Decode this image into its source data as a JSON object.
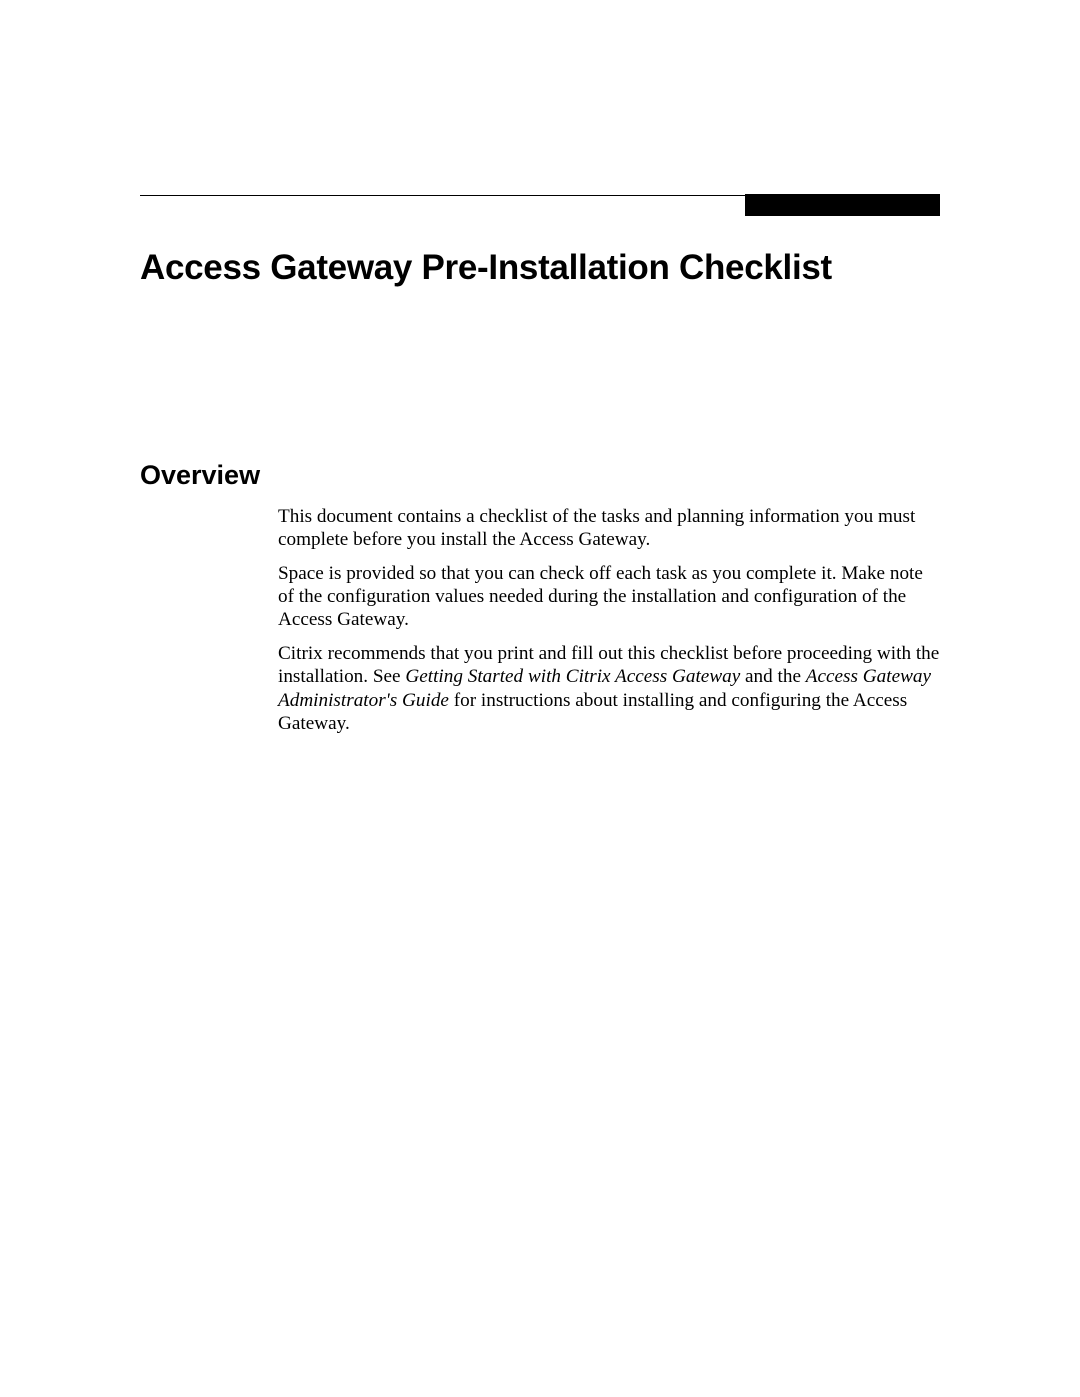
{
  "title": "Access Gateway Pre-Installation Checklist",
  "section": {
    "heading": "Overview",
    "paragraphs": {
      "p1": "This document contains a checklist of the tasks and planning information you must complete before you install the Access Gateway.",
      "p2": "Space is provided so that you can check off each task as you complete it. Make note of the configuration values needed during the installation and configuration of the Access Gateway.",
      "p3_part1": "Citrix recommends that you print and fill out this checklist before proceeding with the installation. See ",
      "p3_italic1": "Getting Started with Citrix Access Gateway",
      "p3_part2": " and the ",
      "p3_italic2": "Access Gateway Administrator's Guide",
      "p3_part3": " for instructions about installing and configuring the Access Gateway."
    }
  }
}
